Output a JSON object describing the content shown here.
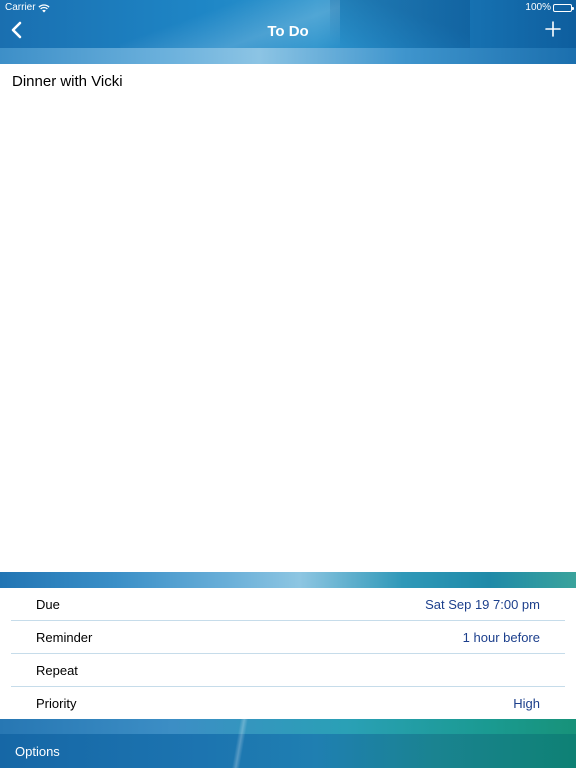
{
  "status_bar": {
    "carrier": "Carrier",
    "battery": "100%"
  },
  "nav": {
    "title": "To Do"
  },
  "task": {
    "title": "Dinner with Vicki"
  },
  "properties": [
    {
      "label": "Due",
      "value": "Sat  Sep 19  7:00 pm"
    },
    {
      "label": "Reminder",
      "value": "1 hour before"
    },
    {
      "label": "Repeat",
      "value": ""
    },
    {
      "label": "Priority",
      "value": "High"
    }
  ],
  "toolbar": {
    "options_label": "Options"
  },
  "colors": {
    "accent": "#1c74b0",
    "value_text": "#1c3f8c",
    "separator": "#c6dcea"
  },
  "icons": {
    "back": "chevron-left-icon",
    "add": "plus-icon",
    "wifi": "wifi-icon",
    "battery": "battery-icon"
  }
}
